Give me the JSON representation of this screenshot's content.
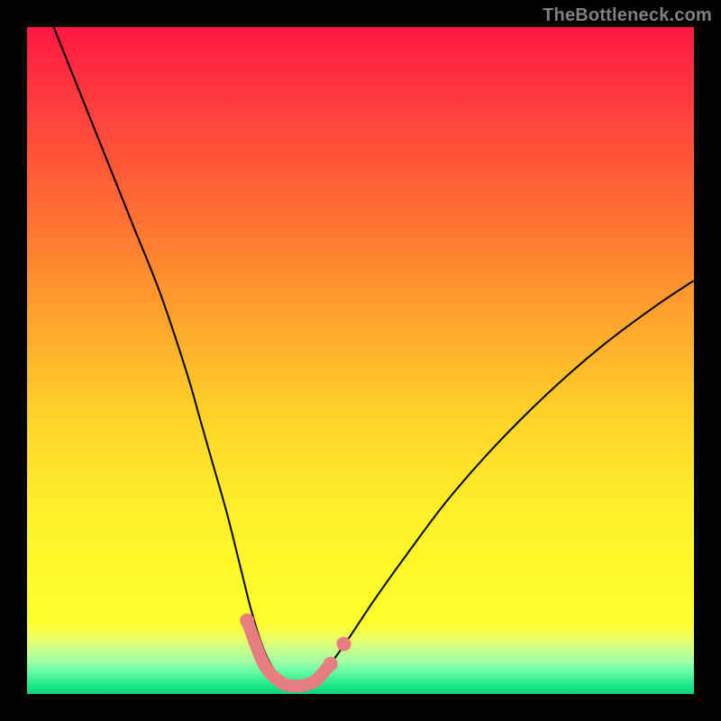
{
  "watermark": "TheBottleneck.com",
  "chart_data": {
    "type": "line",
    "title": "",
    "xlabel": "",
    "ylabel": "",
    "x_range": [
      0,
      100
    ],
    "y_range": [
      0,
      100
    ],
    "series": [
      {
        "name": "left-curve",
        "x": [
          4,
          8,
          12,
          16,
          20,
          24,
          26,
          28,
          30,
          32,
          33.5,
          35,
          36.5,
          38,
          39,
          40
        ],
        "y": [
          100,
          90,
          80,
          70,
          60,
          48,
          41,
          34,
          27,
          19,
          13,
          8,
          4.5,
          2.5,
          1.5,
          1.2
        ]
      },
      {
        "name": "right-curve",
        "x": [
          40,
          42,
          45,
          48,
          52,
          57,
          63,
          70,
          78,
          86,
          94,
          100
        ],
        "y": [
          1.2,
          1.8,
          4,
          8,
          14,
          21,
          29,
          37,
          45,
          52,
          58,
          62
        ]
      }
    ],
    "highlight_segment": {
      "name": "bottleneck-region",
      "x": [
        33,
        35.5,
        38,
        40,
        42,
        43.5,
        45.5
      ],
      "y": [
        11,
        4.5,
        1.8,
        1.2,
        1.4,
        2.2,
        4.5
      ]
    },
    "highlight_dots": [
      {
        "x": 33,
        "y": 11
      },
      {
        "x": 45.5,
        "y": 4.5
      },
      {
        "x": 47.5,
        "y": 7.5
      }
    ],
    "gradient": {
      "top_color": "#ff1740",
      "mid_color": "#fff12a",
      "bottom_color": "#0cd878"
    },
    "annotations": []
  }
}
